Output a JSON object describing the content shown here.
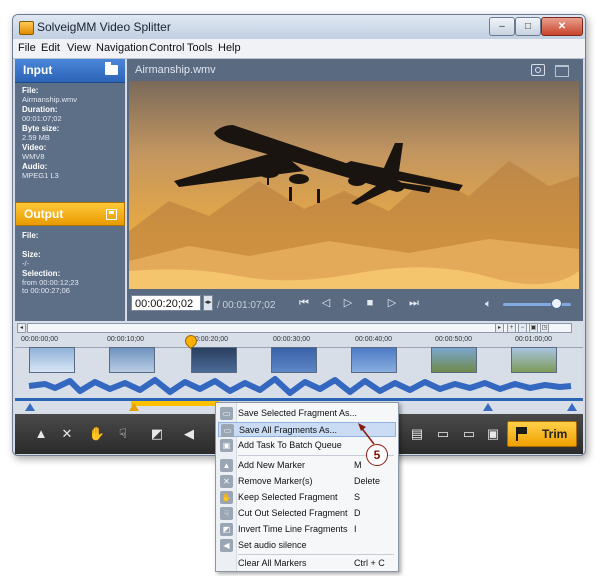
{
  "window": {
    "title": "SolveigMM Video Splitter"
  },
  "menu": [
    "File",
    "Edit",
    "View",
    "Navigation",
    "Control",
    "Tools",
    "Help"
  ],
  "input_panel": {
    "title": "Input",
    "fields": [
      {
        "label": "File:",
        "value": "Airmanship.wmv"
      },
      {
        "label": "Duration:",
        "value": "00:01:07;02"
      },
      {
        "label": "Byte size:",
        "value": "2.59 MB"
      },
      {
        "label": "Video:",
        "value": "WMV8"
      },
      {
        "label": "Audio:",
        "value": "MPEG1 L3"
      }
    ]
  },
  "output_panel": {
    "title": "Output",
    "fields": [
      {
        "label": "File:",
        "value": ""
      },
      {
        "label": "Size:",
        "value": "-/-"
      }
    ],
    "selection_label": "Selection:",
    "selection_from": "from   00:00:12;23",
    "selection_to": "to      00:00:27;06"
  },
  "video": {
    "filename": "Airmanship.wmv",
    "timecode": "00:00:20;02",
    "duration": "/ 00:01:07;02",
    "volume": 0.75
  },
  "player_controls": [
    "prev-fragment",
    "step-back",
    "play",
    "stop",
    "step-forward",
    "next-fragment"
  ],
  "timeline": {
    "ticks": [
      "00:00:00;00",
      "00:00:10;00",
      "00:00:20;00",
      "00:00:30;00",
      "00:00:40;00",
      "00:00:50;00",
      "00:01:00;00"
    ]
  },
  "toolbar": {
    "trim_label": "Trim"
  },
  "context_menu": {
    "items": [
      {
        "label": "Save Selected Fragment As...",
        "shortcut": ""
      },
      {
        "label": "Save All Fragments As...",
        "shortcut": ""
      },
      {
        "label": "Add Task To Batch Queue",
        "shortcut": ""
      },
      {
        "label": "Add New Marker",
        "shortcut": "M"
      },
      {
        "label": "Remove Marker(s)",
        "shortcut": "Delete"
      },
      {
        "label": "Keep Selected Fragment",
        "shortcut": "S"
      },
      {
        "label": "Cut Out Selected Fragment",
        "shortcut": "D"
      },
      {
        "label": "Invert Time Line Fragments",
        "shortcut": "I"
      },
      {
        "label": "Set audio silence",
        "shortcut": ""
      },
      {
        "label": "Clear All Markers",
        "shortcut": "Ctrl + C"
      }
    ]
  },
  "callout": {
    "number": "5"
  },
  "colors": {
    "accent_blue": "#2c64b8",
    "accent_orange": "#f0a000",
    "menu_highlight": "#c9dcf3"
  }
}
